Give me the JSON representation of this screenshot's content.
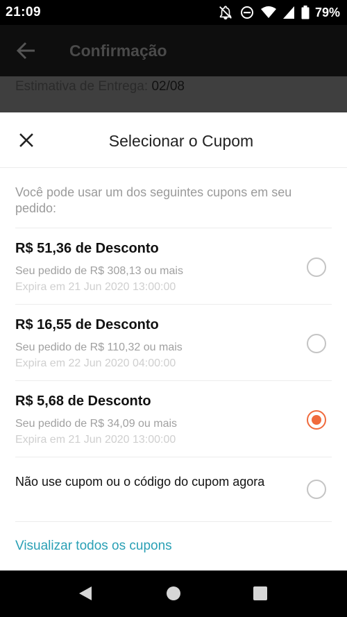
{
  "status_bar": {
    "time": "21:09",
    "battery": "79%",
    "icons": [
      "notifications-off-icon",
      "do-not-disturb-icon",
      "wifi-icon",
      "signal-icon",
      "battery-icon"
    ]
  },
  "app_header": {
    "title": "Confirmação",
    "back_icon": "arrow-left-icon"
  },
  "underlay": {
    "estimate_label": "Estimativa de Entrega:",
    "estimate_value": "02/08"
  },
  "sheet": {
    "title": "Selecionar o Cupom",
    "close_icon": "close-icon",
    "intro": "Você pode usar um dos seguintes cupons em seu pedido:",
    "coupons": [
      {
        "title": "R$ 51,36 de Desconto",
        "min_order": "Seu pedido de R$ 308,13 ou mais",
        "expires": "Expira em 21 Jun 2020 13:00:00",
        "selected": false
      },
      {
        "title": "R$ 16,55 de Desconto",
        "min_order": "Seu pedido de R$ 110,32 ou mais",
        "expires": "Expira em 22 Jun 2020 04:00:00",
        "selected": false
      },
      {
        "title": "R$ 5,68 de Desconto",
        "min_order": "Seu pedido de R$ 34,09 ou mais",
        "expires": "Expira em 21 Jun 2020 13:00:00",
        "selected": true
      }
    ],
    "no_coupon_label": "Não use cupom ou o código do cupom agora",
    "no_coupon_selected": false,
    "view_all": "Visualizar todos os cupons"
  },
  "colors": {
    "accent": "#f06a3c",
    "link": "#2aa0b5"
  },
  "nav_bar": {
    "buttons": [
      "back-triangle-icon",
      "home-circle-icon",
      "recents-square-icon"
    ]
  }
}
